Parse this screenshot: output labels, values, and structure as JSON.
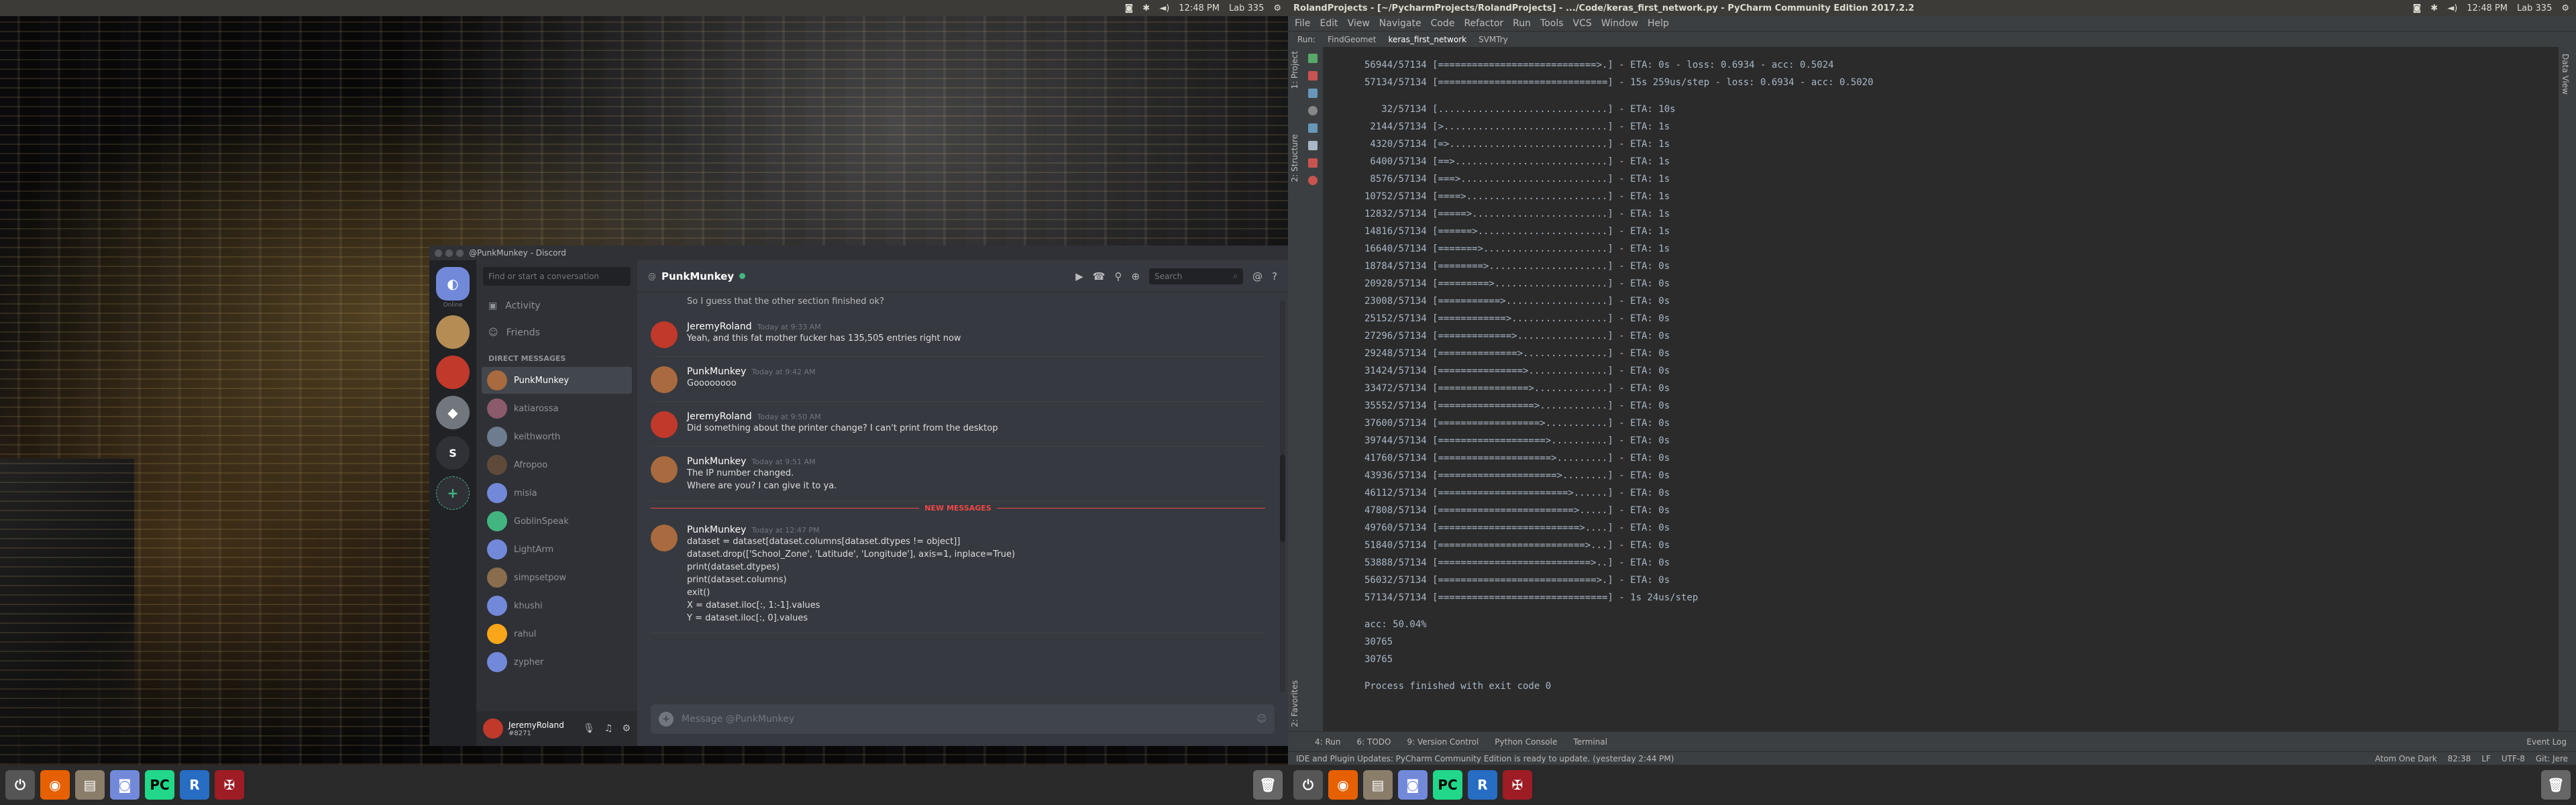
{
  "topbar_left": {
    "time": "12:48 PM",
    "network": "Lab 335"
  },
  "topbar_right": {
    "window_title": "RolandProjects - [~/PycharmProjects/RolandProjects] - .../Code/keras_first_network.py - PyCharm Community Edition 2017.2.2",
    "time": "12:48 PM",
    "network": "Lab 335"
  },
  "discord": {
    "window_title": "@PunkMunkey - Discord",
    "search_placeholder": "Find or start a conversation",
    "home_label": "Online",
    "servers": [
      "S"
    ],
    "nav": {
      "activity": "Activity",
      "friends": "Friends"
    },
    "dm_header": "DIRECT MESSAGES",
    "dms": [
      {
        "name": "PunkMunkey",
        "active": true,
        "color": "#a86a3e"
      },
      {
        "name": "katiarossa",
        "color": "#8b5a6b"
      },
      {
        "name": "keithworth",
        "color": "#6d7c8e"
      },
      {
        "name": "Afropoo",
        "color": "#5f4a3a"
      },
      {
        "name": "misia",
        "color": "#7289da"
      },
      {
        "name": "GoblinSpeak",
        "color": "#43b581"
      },
      {
        "name": "LightArm",
        "color": "#7289da"
      },
      {
        "name": "simpsetpow",
        "color": "#8a6d4d"
      },
      {
        "name": "khushi",
        "color": "#7289da"
      },
      {
        "name": "rahul",
        "color": "#faa61a"
      },
      {
        "name": "zypher",
        "color": "#7289da"
      }
    ],
    "user": {
      "name": "JeremyRoland",
      "sub": "#8271"
    },
    "chat_name": "PunkMunkey",
    "chat_search": "Search",
    "partial_message": "So I guess that the other section finished ok?",
    "messages": [
      {
        "author": "JeremyRoland",
        "time": "Today at 9:33 AM",
        "lines": [
          "Yeah, and this fat mother fucker has 135,505 entries right now"
        ],
        "color": "#c0392b"
      },
      {
        "author": "PunkMunkey",
        "time": "Today at 9:42 AM",
        "lines": [
          "Goooooooo"
        ],
        "color": "#a86a3e"
      },
      {
        "author": "JeremyRoland",
        "time": "Today at 9:50 AM",
        "lines": [
          "Did something about the printer change? I can't print from the desktop"
        ],
        "color": "#c0392b"
      },
      {
        "author": "PunkMunkey",
        "time": "Today at 9:51 AM",
        "lines": [
          "The IP number changed.",
          "Where are you? I can give it to ya."
        ],
        "color": "#a86a3e"
      }
    ],
    "new_messages_label": "NEW MESSAGES",
    "last_message": {
      "author": "PunkMunkey",
      "time": "Today at 12:47 PM",
      "lines": [
        "dataset = dataset[dataset.columns[dataset.dtypes != object]]",
        "dataset.drop(['School_Zone', 'Latitude', 'Longitude'], axis=1, inplace=True)",
        "print(dataset.dtypes)",
        "print(dataset.columns)",
        "exit()",
        "X = dataset.iloc[:, 1:-1].values",
        "Y = dataset.iloc[:, 0].values"
      ]
    },
    "composer_placeholder": "Message @PunkMunkey"
  },
  "pycharm": {
    "menu": [
      "File",
      "Edit",
      "View",
      "Navigate",
      "Code",
      "Refactor",
      "Run",
      "Tools",
      "VCS",
      "Window",
      "Help"
    ],
    "run_tabs": [
      "Run:",
      "FindGeomet",
      "keras_first_network",
      "SVMTry"
    ],
    "left_labels": [
      "1: Project",
      "2: Structure"
    ],
    "favorites_label": "2: Favorites",
    "right_label": "Data View",
    "console_top": [
      "56944/57134 [============================>.] - ETA: 0s - loss: 0.6934 - acc: 0.5024",
      "57134/57134 [==============================] - 15s 259us/step - loss: 0.6934 - acc: 0.5020"
    ],
    "console_progress": [
      "   32/57134 [..............................] - ETA: 10s",
      " 2144/57134 [>.............................] - ETA: 1s",
      " 4320/57134 [=>............................] - ETA: 1s",
      " 6400/57134 [==>...........................] - ETA: 1s",
      " 8576/57134 [===>..........................] - ETA: 1s",
      "10752/57134 [====>.........................] - ETA: 1s",
      "12832/57134 [=====>........................] - ETA: 1s",
      "14816/57134 [======>.......................] - ETA: 1s",
      "16640/57134 [=======>......................] - ETA: 1s",
      "18784/57134 [========>.....................] - ETA: 0s",
      "20928/57134 [=========>....................] - ETA: 0s",
      "23008/57134 [===========>..................] - ETA: 0s",
      "25152/57134 [============>.................] - ETA: 0s",
      "27296/57134 [=============>................] - ETA: 0s",
      "29248/57134 [==============>...............] - ETA: 0s",
      "31424/57134 [===============>..............] - ETA: 0s",
      "33472/57134 [================>.............] - ETA: 0s",
      "35552/57134 [=================>............] - ETA: 0s",
      "37600/57134 [==================>...........] - ETA: 0s",
      "39744/57134 [===================>..........] - ETA: 0s",
      "41760/57134 [====================>.........] - ETA: 0s",
      "43936/57134 [=====================>........] - ETA: 0s",
      "46112/57134 [=======================>......] - ETA: 0s",
      "47808/57134 [========================>.....] - ETA: 0s",
      "49760/57134 [=========================>....] - ETA: 0s",
      "51840/57134 [==========================>...] - ETA: 0s",
      "53888/57134 [===========================>..] - ETA: 0s",
      "56032/57134 [============================>.] - ETA: 0s",
      "57134/57134 [==============================] - 1s 24us/step"
    ],
    "console_tail": [
      "acc: 50.04%",
      "30765",
      "30765"
    ],
    "console_exit": "Process finished with exit code 0",
    "bottom_tabs": [
      "4: Run",
      "6: TODO",
      "9: Version Control",
      "Python Console",
      "Terminal"
    ],
    "event_log": "Event Log",
    "status_message": "IDE and Plugin Updates: PyCharm Community Edition is ready to update. (yesterday 2:44 PM)",
    "status_right": [
      "Atom One Dark",
      "82:38",
      "LF",
      "UTF-8",
      "Git: Jere"
    ]
  },
  "taskbar_icons": [
    "power-icon",
    "firefox-icon",
    "files-icon",
    "discord-icon",
    "pycharm-icon",
    "r-icon",
    "mendeley-icon"
  ]
}
